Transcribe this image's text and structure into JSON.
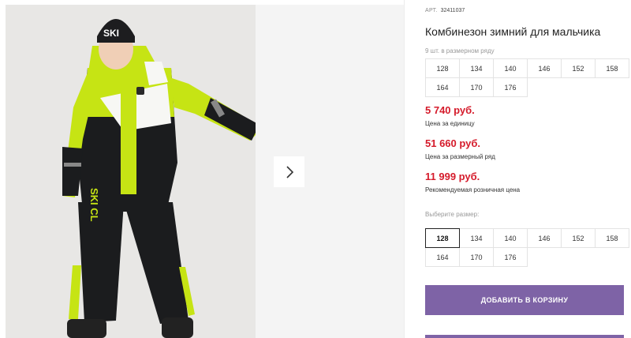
{
  "gallery": {
    "image_alt": "Комбинезон зимний для мальчика",
    "hat_text": "SKI",
    "leg_text": "SKI CL",
    "next_icon": "chevron-right-icon",
    "colors": {
      "lime": "#c6e414",
      "black": "#1b1c1e",
      "white": "#f7f7f4"
    }
  },
  "product": {
    "sku_label": "АРТ.",
    "sku_value": "32411037",
    "title": "Комбинезон зимний для мальчика",
    "size_row_note": "9 шт. в размерном ряду",
    "size_row": [
      "128",
      "134",
      "140",
      "146",
      "152",
      "158",
      "164",
      "170",
      "176"
    ],
    "prices": {
      "unit_price": "5 740 руб.",
      "unit_label": "Цена за единицу",
      "row_price": "51 660 руб.",
      "row_label": "Цена за размерный ряд",
      "retail_price": "11 999 руб.",
      "retail_label": "Рекомендуемая розничная цена"
    },
    "size_select_label": "Выберите размер:",
    "size_options": [
      "128",
      "134",
      "140",
      "146",
      "152",
      "158",
      "164",
      "170",
      "176"
    ],
    "selected_size": "128",
    "add_to_cart": "ДОБАВИТЬ В КОРЗИНУ",
    "accent_color": "#7e63a6",
    "price_color": "#d51b2b"
  }
}
